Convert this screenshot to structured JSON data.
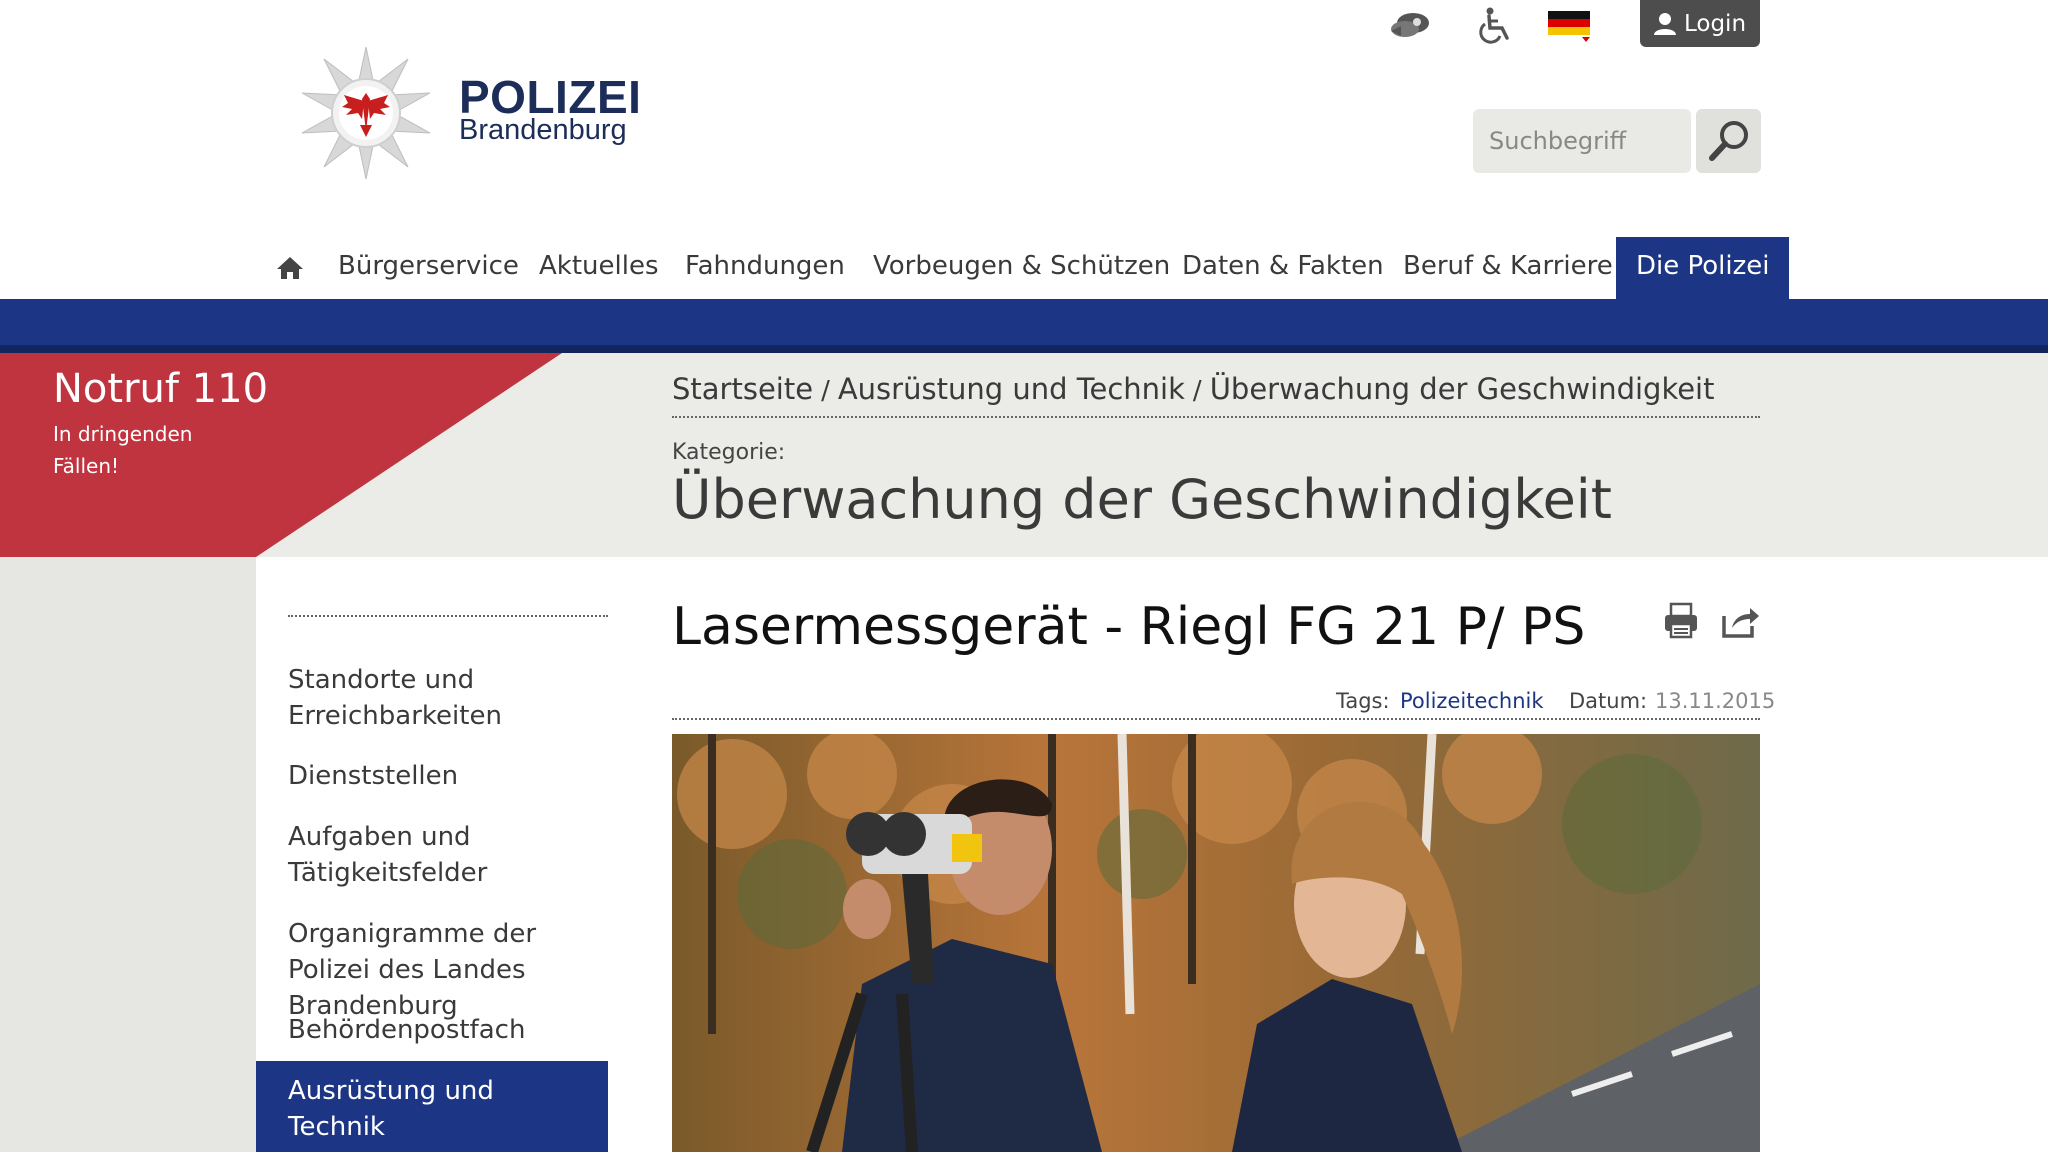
{
  "header": {
    "utility": {
      "sign_language_icon": "sign-language-icon",
      "accessibility_icon": "wheelchair-icon",
      "language_icon": "german-flag-icon",
      "login_label": "Login"
    },
    "logo": {
      "title": "POLIZEI",
      "subtitle": "Brandenburg"
    },
    "search": {
      "placeholder": "Suchbegriff"
    }
  },
  "nav": {
    "home_icon": "home-icon",
    "items": [
      {
        "label": "Bürgerservice"
      },
      {
        "label": "Aktuelles"
      },
      {
        "label": "Fahndungen"
      },
      {
        "label": "Vorbeugen & Schützen"
      },
      {
        "label": "Daten & Fakten"
      },
      {
        "label": "Beruf & Karriere"
      },
      {
        "label": "Die Polizei"
      }
    ],
    "active_index": 6
  },
  "emergency": {
    "title": "Notruf 110",
    "subtitle": "In dringenden Fällen!"
  },
  "breadcrumb": [
    "Startseite",
    "Ausrüstung und Technik",
    "Überwachung der Geschwindigkeit"
  ],
  "category": {
    "label": "Kategorie:",
    "title": "Überwachung der Geschwindigkeit"
  },
  "sidebar": {
    "items": [
      {
        "label": "Standorte und Erreichbarkeiten"
      },
      {
        "label": "Dienststellen"
      },
      {
        "label": "Aufgaben und Tätigkeitsfelder"
      },
      {
        "label": "Organigramme der Polizei des Landes Brandenburg"
      },
      {
        "label": "Behördenpostfach"
      },
      {
        "label": "Ausrüstung und Technik"
      }
    ],
    "active_index": 5
  },
  "article": {
    "title": "Lasermessgerät - Riegl FG 21 P/ PS",
    "tags_label": "Tags:",
    "tag": "Polizeitechnik",
    "date_label": "Datum:",
    "date": "13.11.2015",
    "print_icon": "print-icon",
    "share_icon": "share-icon"
  },
  "colors": {
    "brand_blue": "#1c3584",
    "emergency_red": "#c0343f",
    "grey_band": "#ebebe8"
  }
}
